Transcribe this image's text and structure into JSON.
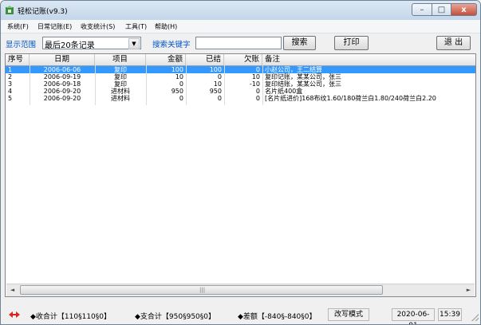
{
  "window": {
    "title": "轻松记账(v9.3)",
    "minimize": "–",
    "maximize": "□",
    "close": "x"
  },
  "menu": [
    "系统(F)",
    "日常记账(E)",
    "收支统计(S)",
    "工具(T)",
    "帮助(H)"
  ],
  "toolbar": {
    "range_label": "显示范围",
    "range_value": "最后20条记录",
    "search_label": "搜索关键字",
    "search_value": "",
    "search_button": "搜索",
    "print_button": "打印",
    "exit_button": "退 出"
  },
  "table": {
    "columns": [
      "序号",
      "日期",
      "项目",
      "金额",
      "已结",
      "欠账",
      "备注"
    ],
    "rows": [
      {
        "no": "1",
        "date": "2006-06-06",
        "item": "复印",
        "amount": "100",
        "settled": "100",
        "owed": "0",
        "note": "小赵公司，王二结算",
        "selected": true
      },
      {
        "no": "2",
        "date": "2006-09-19",
        "item": "复印",
        "amount": "10",
        "settled": "0",
        "owed": "10",
        "note": "复印记账，某某公司，张三",
        "selected": false
      },
      {
        "no": "3",
        "date": "2006-09-18",
        "item": "复印",
        "amount": "0",
        "settled": "10",
        "owed": "-10",
        "note": "复印结账，某某公司，张三",
        "selected": false
      },
      {
        "no": "4",
        "date": "2006-09-20",
        "item": "进材料",
        "amount": "950",
        "settled": "950",
        "owed": "0",
        "note": "名片纸400盒",
        "selected": false
      },
      {
        "no": "5",
        "date": "2006-09-20",
        "item": "进材料",
        "amount": "0",
        "settled": "0",
        "owed": "0",
        "note": "[名片纸进价]168布纹1.60/180荷兰白1.80/240荷兰白2.20",
        "selected": false
      }
    ]
  },
  "scrollbar": {
    "left": "◄",
    "right": "►",
    "grip": "|||"
  },
  "status": {
    "income": "◆收合计【110§110§0】",
    "expense": "◆支合计【950§950§0】",
    "diff": "◆差额【-840§-840§0】",
    "mode": "改写模式",
    "date": "2020-06-01",
    "time": "15:39"
  },
  "colors": {
    "selection": "#3399ff",
    "label_blue": "#0055cc",
    "title_bar": "#c4d6ea"
  }
}
